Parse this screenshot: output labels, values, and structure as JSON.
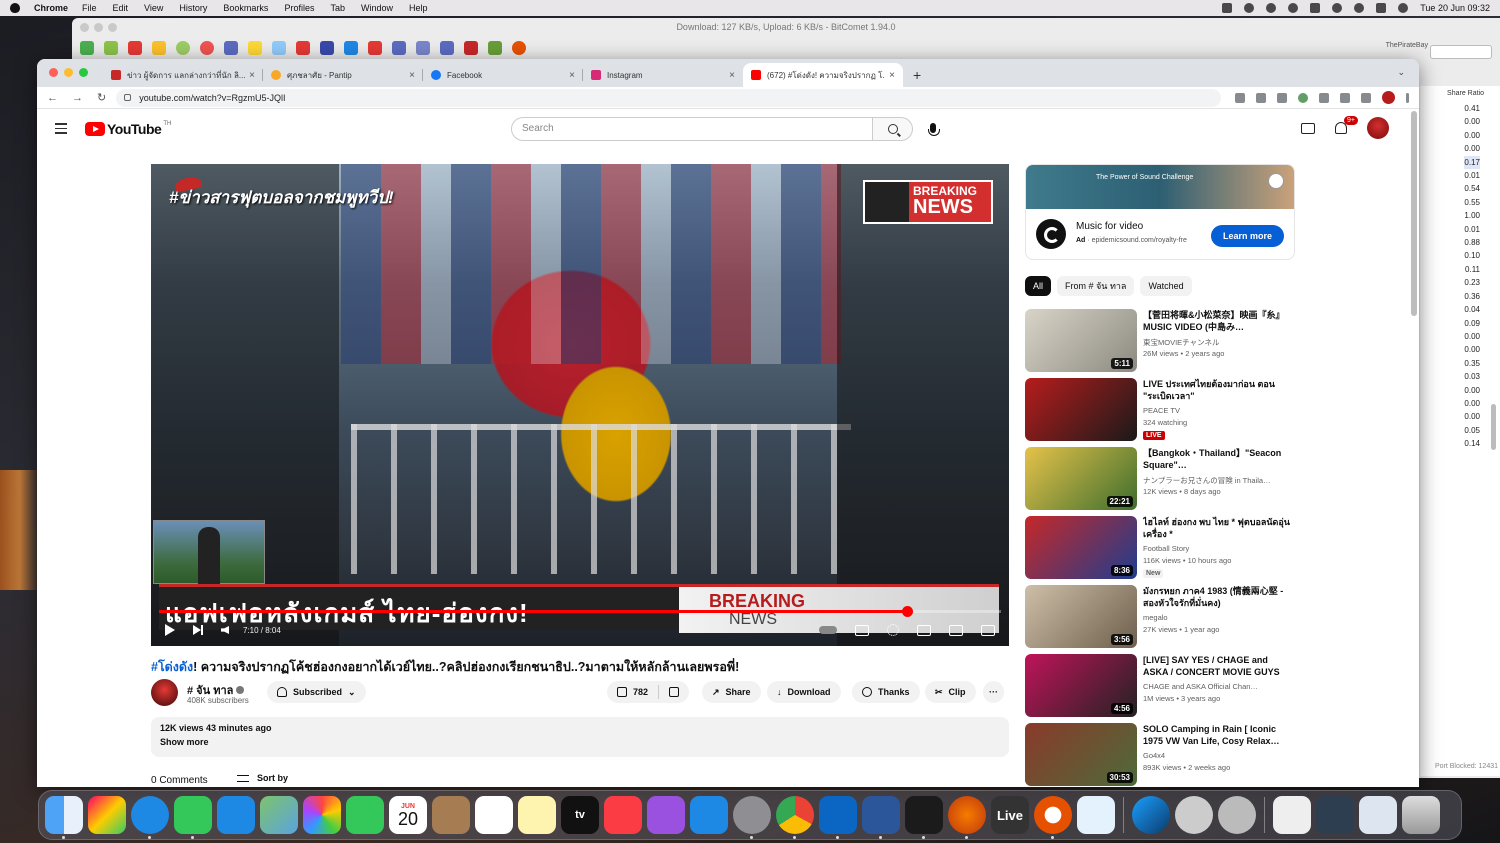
{
  "menubar": {
    "app": "Chrome",
    "items": [
      "File",
      "Edit",
      "View",
      "History",
      "Bookmarks",
      "Profiles",
      "Tab",
      "Window",
      "Help"
    ],
    "clock": "Tue 20 Jun  09:32"
  },
  "bitcomet": {
    "title": "Download: 127 KB/s, Upload: 6 KB/s - BitComet 1.94.0",
    "pirate_label": "ThePirateBay",
    "share_header": "Share Ratio",
    "share_ratios": [
      "0.41",
      "0.00",
      "0.00",
      "0.00",
      "0.17",
      "0.01",
      "0.54",
      "0.55",
      "1.00",
      "0.01",
      "0.88",
      "0.10",
      "0.11",
      "0.23",
      "0.36",
      "0.04",
      "0.09",
      "0.00",
      "0.00",
      "0.35",
      "0.03",
      "0.00",
      "0.00",
      "0.00",
      "0.05",
      "0.14"
    ],
    "port_status": "Port Blocked: 12431"
  },
  "chrome": {
    "tabs": [
      {
        "label": "ข่าว ผู้จัดการ แลกล่างกว่าที่นัก ลิ...",
        "favicon_color": "#c62828"
      },
      {
        "label": "ศุภชลาศัย - Pantip",
        "favicon_color": "#f9a825"
      },
      {
        "label": "Facebook",
        "favicon_color": "#1877f2"
      },
      {
        "label": "Instagram",
        "favicon_color": "#d62976"
      },
      {
        "label": "(672) #โด่งดัง! ความจริงปรากฏ โ...",
        "favicon_color": "#ff0000"
      }
    ],
    "url": "youtube.com/watch?v=RgzmU5-JQlI"
  },
  "youtube": {
    "logo_text": "YouTube",
    "logo_sup": "TH",
    "search_placeholder": "Search",
    "notif_count": "9+",
    "video": {
      "overlay_top": "#ข่าวสารฟุตบอลจากชมพูทวีป!",
      "breaking_1": "BREAKING",
      "breaking_2": "NEWS",
      "lower_text": "แอฟเฟอหลังเกมส์ ไทย-ฮ่องกง!",
      "lower_break_1": "BREAKING",
      "lower_break_2": "NEWS",
      "time": "7:10 / 8:04",
      "progress": 0.888
    },
    "title_hash": "#โด่งดัง",
    "title_rest": "! ความจริงปรากฏโค้ชฮ่องกงอยากได้เวย์ไทย..?คลิปฮ่องกงเรียกชนาธิป..?มาตามให้หลักล้านเลยพรอพี่!",
    "channel": {
      "name": "# จัน ทาล",
      "subs": "408K subscribers"
    },
    "buttons": {
      "subscribed": "Subscribed",
      "likes": "782",
      "share": "Share",
      "download": "Download",
      "thanks": "Thanks",
      "clip": "Clip",
      "more": "···"
    },
    "description": {
      "meta": "12K views  43 minutes ago",
      "show_more": "Show more"
    },
    "comments": {
      "count": "0 Comments",
      "sort": "Sort by"
    },
    "ad": {
      "banner_text": "The Power of Sound Challenge",
      "title": "Music for video",
      "ad_label": "Ad",
      "domain": "· epidemicsound.com/royalty-fre",
      "cta": "Learn more"
    },
    "chips": [
      "All",
      "From # จัน ทาล",
      "Watched"
    ],
    "recommendations": [
      {
        "title": "【菅田将暉&小松菜奈】映画『糸』MUSIC VIDEO (中島み…",
        "channel": "東宝MOVIEチャンネル",
        "meta": "26M views  • 2 years ago",
        "duration": "5:11",
        "badge": "",
        "colors": [
          "#d9d4c8",
          "#8c8a80"
        ]
      },
      {
        "title": "LIVE ประเทศไทยต้องมาก่อน ตอน \"ระเบิดเวลา\"",
        "channel": "PEACE TV",
        "meta": "324 watching",
        "duration": "",
        "badge": "LIVE",
        "colors": [
          "#b71c1c",
          "#1a1a1a"
        ]
      },
      {
        "title": "【Bangkok・Thailand】\"Seacon Square\"…",
        "channel": "ナンプラーお兄さんの冒険 in Thaila…",
        "meta": "12K views  • 8 days ago",
        "duration": "22:21",
        "badge": "",
        "colors": [
          "#e6c24a",
          "#3d6e2e"
        ]
      },
      {
        "title": "ไฮไลท์ ฮ่องกง พบ ไทย * ฟุตบอลนัดอุ่นเครื่อง *",
        "channel": "Football Story",
        "meta": "116K views  • 10 hours ago",
        "duration": "8:36",
        "badge": "New",
        "colors": [
          "#c62828",
          "#1e3d8f"
        ]
      },
      {
        "title": "มังกรหยก ภาค4 1983 (情義兩心堅 - สองหัวใจรักที่มั่นคง)",
        "channel": "megalo",
        "meta": "27K views  • 1 year ago",
        "duration": "3:56",
        "badge": "",
        "colors": [
          "#cdbfa8",
          "#6d5f4b"
        ]
      },
      {
        "title": "[LIVE] SAY YES / CHAGE and ASKA / CONCERT MOVIE GUYS",
        "channel": "CHAGE and ASKA Official Chan…",
        "meta": "1M views  • 3 years ago",
        "duration": "4:56",
        "badge": "",
        "colors": [
          "#c0145a",
          "#222"
        ]
      },
      {
        "title": "SOLO Camping in Rain [ Iconic 1975 VW Van Life, Cosy Relax…",
        "channel": "Go4x4",
        "meta": "893K views  • 2 weeks ago",
        "duration": "30:53",
        "badge": "",
        "colors": [
          "#8a3a2a",
          "#4d6b3a"
        ]
      }
    ]
  },
  "dock": {
    "calendar_month": "JUN",
    "calendar_day": "20",
    "tv_label": "tv",
    "live_label": "Live"
  }
}
